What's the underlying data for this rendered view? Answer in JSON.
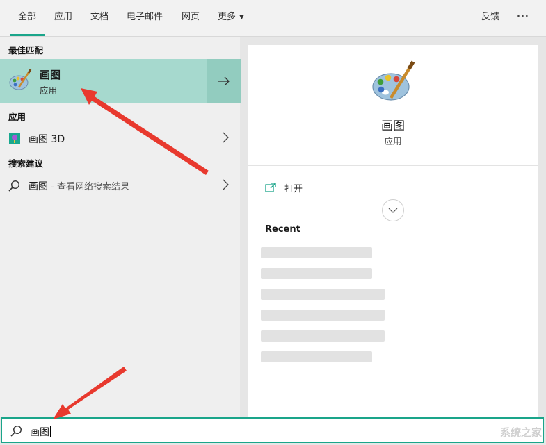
{
  "tabs": [
    {
      "label": "全部",
      "active": true
    },
    {
      "label": "应用"
    },
    {
      "label": "文档"
    },
    {
      "label": "电子邮件"
    },
    {
      "label": "网页"
    },
    {
      "label": "更多"
    }
  ],
  "header": {
    "feedback": "反馈",
    "more_options": "···"
  },
  "left": {
    "best_match_label": "最佳匹配",
    "best_match": {
      "title": "画图",
      "subtitle": "应用"
    },
    "apps_label": "应用",
    "apps": [
      {
        "label": "画图 3D"
      }
    ],
    "suggest_label": "搜索建议",
    "suggestions": [
      {
        "term": "画图",
        "suffix": " - 查看网络搜索结果"
      }
    ]
  },
  "right": {
    "title": "画图",
    "subtitle": "应用",
    "open_label": "打开",
    "recent_label": "Recent"
  },
  "search": {
    "value": "画图"
  },
  "watermark": "系统之家",
  "colors": {
    "accent": "#1aa58a",
    "selection": "#a6d9ce",
    "annotation": "#e8392e"
  },
  "icons": [
    "paint-palette-icon",
    "paint3d-icon",
    "search-icon",
    "arrow-right-icon",
    "chevron-right-icon",
    "open-icon",
    "chevron-down-icon"
  ]
}
